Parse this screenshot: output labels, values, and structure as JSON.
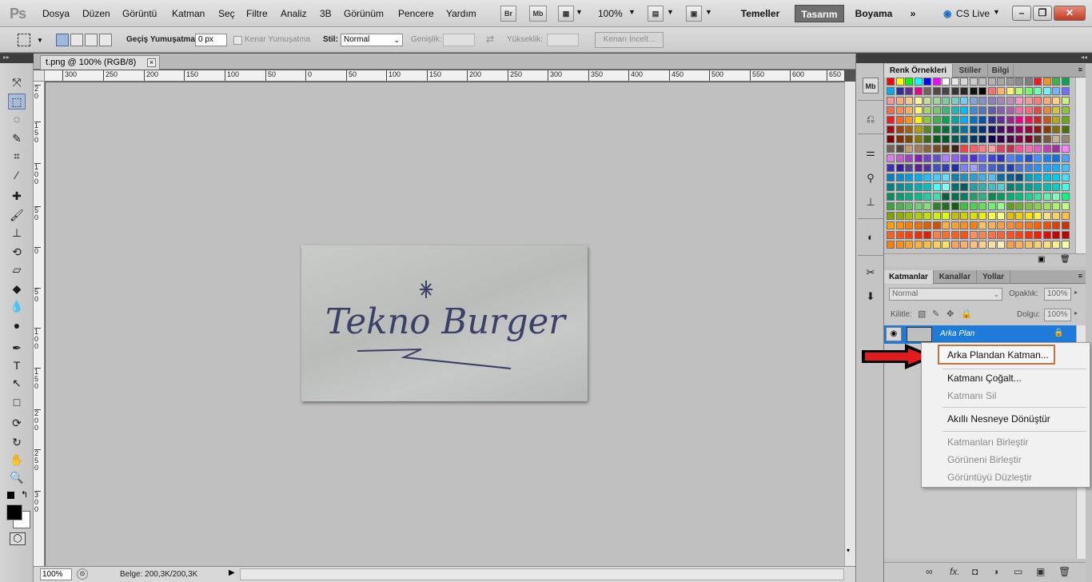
{
  "app": {
    "logo": "Ps"
  },
  "menu": [
    "Dosya",
    "Düzen",
    "Görüntü",
    "Katman",
    "Seç",
    "Filtre",
    "Analiz",
    "3B",
    "Görünüm",
    "Pencere",
    "Yardım"
  ],
  "appbar": {
    "bridge": "Br",
    "minibridge": "Mb",
    "zoom": "100%"
  },
  "workspaces": [
    "Temeller",
    "Tasarım",
    "Boyama"
  ],
  "cslive": "CS Live",
  "options": {
    "feather_label": "Geçiş Yumuşatma:",
    "feather_value": "0 px",
    "antialias_label": "Kenar Yumuşatma",
    "style_label": "Stil:",
    "style_value": "Normal",
    "width_label": "Genişlik:",
    "height_label": "Yükseklik:",
    "refine_edge": "Kenarı İncelt..."
  },
  "document": {
    "tab_title": "t.png @ 100% (RGB/8)",
    "close_glyph": "×",
    "ruler_h": [
      "300",
      "250",
      "200",
      "150",
      "100",
      "50",
      "0",
      "50",
      "100",
      "150",
      "200",
      "250",
      "300",
      "350",
      "400",
      "450",
      "500",
      "550",
      "600",
      "650"
    ],
    "ruler_v": [
      "2 0",
      "1 5 0",
      "1 0 0",
      "5 0",
      "0",
      "5 0",
      "1 0 0",
      "1 5 0",
      "2 0 0",
      "2 5 0",
      "3 0 0"
    ],
    "image_text": "Tekno Burger"
  },
  "status": {
    "zoom": "100%",
    "doc_size": "Belge: 200,3K/200,3K"
  },
  "panels": {
    "swatches_tabs": [
      "Renk Örnekleri",
      "Stiller",
      "Bilgi"
    ],
    "swatch_colors": [
      [
        "#ff0000",
        "#ffff00",
        "#00ff00",
        "#00ffff",
        "#0000ff",
        "#ff00ff",
        "#ffffff",
        "#e6e6e6",
        "#d9d9d9",
        "#cccccc",
        "#bfbfbf",
        "#b3b3b3",
        "#a6a6a6",
        "#999999",
        "#8c8c8c",
        "#808080",
        "#ee1d24",
        "#f7941d",
        "#39b54a",
        "#00a651"
      ],
      [
        "#00aeef",
        "#2e3192",
        "#662d91",
        "#ec008c",
        "#736357",
        "#534741",
        "#464646",
        "#363636",
        "#262626",
        "#111111",
        "#000000",
        "#ff6e6e",
        "#ffb46e",
        "#fff46e",
        "#b4ff6e",
        "#6eff6e",
        "#6effb4",
        "#6ef4ff",
        "#6eb4ff",
        "#6e6eff"
      ],
      [
        "#f5989d",
        "#f9ad81",
        "#fdc68a",
        "#fff799",
        "#c4df9b",
        "#a2d39c",
        "#82ca9d",
        "#7bcdc8",
        "#6ecff6",
        "#7ea7d8",
        "#8493ca",
        "#8882be",
        "#a187be",
        "#bc8dbf",
        "#f49ac2",
        "#f6989d",
        "#ff7b7b",
        "#ffaa77",
        "#ffd27b",
        "#c9f27b"
      ],
      [
        "#f26c4f",
        "#f68e55",
        "#fbaf5c",
        "#fff467",
        "#acd372",
        "#7cc576",
        "#3bb878",
        "#1abbb4",
        "#00bff3",
        "#438ccb",
        "#5574b9",
        "#605ca8",
        "#855fa8",
        "#a763a8",
        "#f06eaa",
        "#f26d7d",
        "#e34a4a",
        "#e58a3a",
        "#d5c43a",
        "#8fc43a"
      ],
      [
        "#ed1c24",
        "#f26522",
        "#f7941d",
        "#fff200",
        "#8dc63f",
        "#39b54a",
        "#00a651",
        "#00a99d",
        "#00aeef",
        "#0072bc",
        "#0054a6",
        "#2e3192",
        "#662d91",
        "#92278f",
        "#ec008c",
        "#ed145b",
        "#c62a2a",
        "#c65a1a",
        "#b8a51a",
        "#6fa51a"
      ],
      [
        "#9e0b0f",
        "#a0410d",
        "#a36209",
        "#aba000",
        "#598527",
        "#1a7b30",
        "#007236",
        "#00746b",
        "#0076a3",
        "#004b80",
        "#003471",
        "#1b1464",
        "#440e62",
        "#630460",
        "#9e005d",
        "#9e0039",
        "#8a1a1a",
        "#8a3a0a",
        "#806f0a",
        "#4a700a"
      ],
      [
        "#790000",
        "#7b2e00",
        "#7d4900",
        "#827b00",
        "#406618",
        "#005e20",
        "#005826",
        "#005952",
        "#005b7f",
        "#003663",
        "#002157",
        "#0d004c",
        "#32004b",
        "#4b0049",
        "#7b0046",
        "#7a0026",
        "#5a3a2a",
        "#7a5a3a",
        "#c7b299",
        "#998675"
      ],
      [
        "#736357",
        "#534741",
        "#c69c6d",
        "#a67c52",
        "#8c6239",
        "#754c24",
        "#603913",
        "#3c2415",
        "#ff4040",
        "#ff6060",
        "#ff8080",
        "#ffa0a0",
        "#e04060",
        "#c03050",
        "#ff50a0",
        "#ff70b0",
        "#e060c0",
        "#c040b0",
        "#a030a0",
        "#ff80ff"
      ],
      [
        "#e080e0",
        "#c060d0",
        "#a040c0",
        "#8020b0",
        "#7040c0",
        "#6050d0",
        "#b080ff",
        "#9060f0",
        "#7040e0",
        "#5030d0",
        "#6060ff",
        "#4040e0",
        "#3030c0",
        "#5080ff",
        "#3070f0",
        "#2050d0",
        "#4090ff",
        "#2080f0",
        "#1070e0",
        "#50a0ff"
      ],
      [
        "#4030b0",
        "#3020a0",
        "#504090",
        "#602090",
        "#5030a0",
        "#4050c0",
        "#3040b0",
        "#2030a0",
        "#8080ff",
        "#a0a0ff",
        "#6070e0",
        "#4060d0",
        "#3050c0",
        "#2040b0",
        "#5070d0",
        "#4080e0",
        "#3090f0",
        "#20a0ff",
        "#10b0ff",
        "#40c0ff"
      ],
      [
        "#0080c0",
        "#0090d0",
        "#00a0e0",
        "#00b0f0",
        "#20c0ff",
        "#40d0ff",
        "#60e0ff",
        "#1080b0",
        "#2090c0",
        "#30a0d0",
        "#40b0e0",
        "#50c0f0",
        "#0070a0",
        "#006090",
        "#005080",
        "#00a0c0",
        "#00b0d0",
        "#00c0e0",
        "#00d0f0",
        "#40e0ff"
      ],
      [
        "#008080",
        "#009090",
        "#00a0a0",
        "#00b0b0",
        "#00c0c0",
        "#40ffff",
        "#80ffff",
        "#007070",
        "#006060",
        "#20a0a0",
        "#30b0b0",
        "#40c0c0",
        "#50d0d0",
        "#008070",
        "#009080",
        "#00a090",
        "#00b0a0",
        "#00c0b0",
        "#00d0c0",
        "#40ffe0"
      ],
      [
        "#009060",
        "#00a070",
        "#00b080",
        "#00c090",
        "#20d0a0",
        "#40e0b0",
        "#006040",
        "#007050",
        "#008060",
        "#20a070",
        "#30b080",
        "#009050",
        "#00a060",
        "#00b070",
        "#00c080",
        "#20d090",
        "#40e0a0",
        "#60f0b0",
        "#80ffc0",
        "#00ff80"
      ],
      [
        "#40a040",
        "#50b050",
        "#60c060",
        "#70d070",
        "#80e080",
        "#308030",
        "#207020",
        "#106010",
        "#40c040",
        "#50d050",
        "#60e060",
        "#70f070",
        "#90ff90",
        "#60a020",
        "#70b030",
        "#80c040",
        "#90d050",
        "#a0e060",
        "#b0f070",
        "#c0ff80"
      ],
      [
        "#80a000",
        "#90b000",
        "#a0c000",
        "#b0d000",
        "#c0e000",
        "#d0f000",
        "#e0ff00",
        "#c0c000",
        "#d0d000",
        "#e0e000",
        "#f0f000",
        "#ffff40",
        "#ffff80",
        "#e0c000",
        "#f0d000",
        "#ffe000",
        "#fff040",
        "#ffe080",
        "#ffd060",
        "#ffc040"
      ],
      [
        "#ffa000",
        "#ff9000",
        "#ff8000",
        "#f07000",
        "#e06000",
        "#d05000",
        "#ffb040",
        "#ffa030",
        "#ff9020",
        "#ff8010",
        "#ffc060",
        "#ffb050",
        "#ffa040",
        "#ff9030",
        "#ff8020",
        "#ff7010",
        "#ff6000",
        "#f05000",
        "#e04000",
        "#d03000"
      ],
      [
        "#ff6020",
        "#ff5010",
        "#ff4000",
        "#f03000",
        "#e02000",
        "#ff8040",
        "#ff7030",
        "#ff6020",
        "#ff5010",
        "#ff9060",
        "#ff8050",
        "#ff7040",
        "#ff6030",
        "#ff5020",
        "#ff4010",
        "#ff3000",
        "#f02000",
        "#e01000",
        "#d00000",
        "#c00000"
      ],
      [
        "#ff8000",
        "#ff9010",
        "#ffa020",
        "#ffb030",
        "#ffc040",
        "#ffd050",
        "#ffe060",
        "#ffa060",
        "#ffb070",
        "#ffc080",
        "#ffd090",
        "#ffe0a0",
        "#fff0b0",
        "#ffa040",
        "#ffb050",
        "#ffc060",
        "#ffd070",
        "#ffe080",
        "#fff090",
        "#ffffa0"
      ]
    ],
    "layers_tabs": [
      "Katmanlar",
      "Kanallar",
      "Yollar"
    ],
    "blend_mode": "Normal",
    "opacity_label": "Opaklık:",
    "opacity_value": "100%",
    "lock_label": "Kilitle:",
    "fill_label": "Dolgu:",
    "fill_value": "100%",
    "layer_name": "Arka Plan"
  },
  "context_menu": {
    "items": [
      {
        "label": "Arka Plandan Katman...",
        "enabled": true
      },
      {
        "label": "Katmanı Çoğalt...",
        "enabled": true
      },
      {
        "label": "Katmanı Sil",
        "enabled": false
      },
      {
        "label": "Akıllı Nesneye Dönüştür",
        "enabled": true
      },
      {
        "label": "Katmanları Birleştir",
        "enabled": false
      },
      {
        "label": "Görüneni Birleştir",
        "enabled": false
      },
      {
        "label": "Görüntüyü Düzleştir",
        "enabled": false
      }
    ]
  },
  "colors": {
    "accent": "#1f7bd9",
    "highlight_border": "#c0733d",
    "arrow": "#e51b1b"
  }
}
